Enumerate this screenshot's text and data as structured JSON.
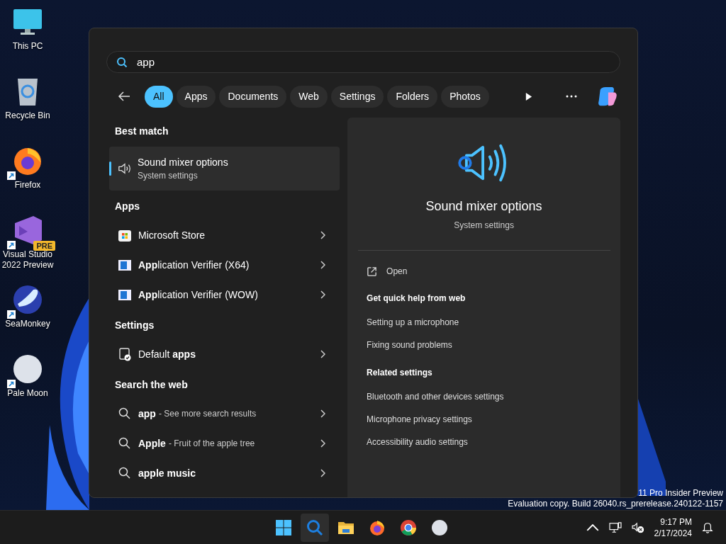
{
  "desktop_icons": [
    {
      "label": "This PC",
      "shortcut": false
    },
    {
      "label": "Recycle Bin",
      "shortcut": false
    },
    {
      "label": "Firefox",
      "shortcut": true
    },
    {
      "label": "Visual Studio 2022 Preview",
      "shortcut": true,
      "badge": "PRE"
    },
    {
      "label": "SeaMonkey",
      "shortcut": true
    },
    {
      "label": "Pale Moon",
      "shortcut": true
    }
  ],
  "search": {
    "value": "app"
  },
  "filters": [
    {
      "label": "All",
      "selected": true
    },
    {
      "label": "Apps",
      "selected": false
    },
    {
      "label": "Documents",
      "selected": false
    },
    {
      "label": "Web",
      "selected": false
    },
    {
      "label": "Settings",
      "selected": false
    },
    {
      "label": "Folders",
      "selected": false
    },
    {
      "label": "Photos",
      "selected": false
    }
  ],
  "best_match": {
    "heading": "Best match",
    "title": "Sound mixer options",
    "subtitle": "System settings",
    "selected": true
  },
  "groups": [
    {
      "heading": "Apps",
      "items": [
        {
          "kind": "store",
          "label": "Microsoft Store"
        },
        {
          "kind": "app",
          "label": "**App**lication Verifier (X64)"
        },
        {
          "kind": "app",
          "label": "**App**lication Verifier (WOW)"
        }
      ]
    },
    {
      "heading": "Settings",
      "items": [
        {
          "kind": "settings",
          "label": "Default **apps**"
        }
      ]
    }
  ],
  "web": {
    "heading": "Search the web",
    "items": [
      {
        "query": "app",
        "description": "- See more search results"
      },
      {
        "query": "Apple",
        "description": "- Fruit of the apple tree"
      },
      {
        "query": "apple music"
      }
    ]
  },
  "preview": {
    "title": "Sound mixer options",
    "subtitle": "System settings",
    "open": "Open",
    "sections": [
      {
        "heading": "Get quick help from web",
        "links": [
          "Setting up a microphone",
          "Fixing sound problems"
        ]
      },
      {
        "heading": "Related settings",
        "links": [
          "Bluetooth and other devices settings",
          "Microphone privacy settings",
          "Accessibility audio settings"
        ]
      }
    ]
  },
  "watermark": [
    "11 Pro Insider Preview",
    "Evaluation copy. Build 26040.rs_prerelease.240122-1157"
  ],
  "taskbar": {
    "apps": [
      {
        "selected": false
      },
      {
        "selected": true
      },
      {
        "selected": false
      },
      {
        "selected": false
      },
      {
        "selected": false
      },
      {
        "selected": false
      }
    ],
    "time": "9:17 PM",
    "date": "2/17/2024"
  }
}
